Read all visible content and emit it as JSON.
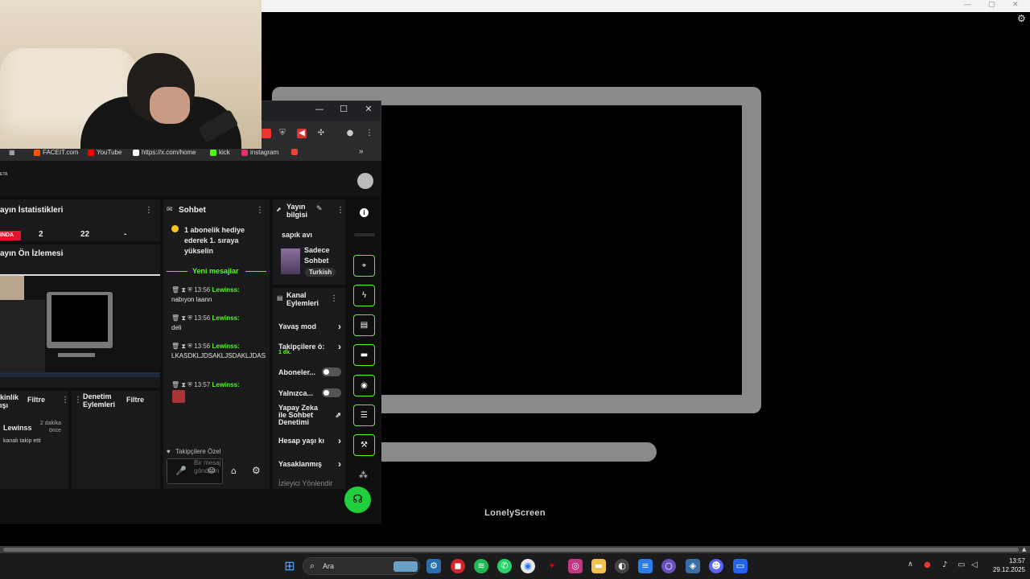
{
  "host": {
    "app_label": "LonelyScreen",
    "controls": {
      "minimize": "—",
      "maximize": "▢",
      "close": "✕"
    }
  },
  "browser": {
    "controls": {
      "minimize": "—",
      "maximize": "☐",
      "close": "✕"
    },
    "bookmarks": [
      {
        "label": "FACEIT.com",
        "color": "#ff5500"
      },
      {
        "label": "YouTube",
        "color": "#ff0000"
      },
      {
        "label": "https://x.com/home",
        "color": "#ffffff"
      },
      {
        "label": "kick",
        "color": "#53fc18"
      },
      {
        "label": "instagram",
        "color": "#e1306c"
      }
    ],
    "more_label": "»"
  },
  "dashboard": {
    "header_logo": "ETA",
    "stats": {
      "title": "ayın İstatistikleri",
      "live_badge": "INDA",
      "values": [
        "2",
        "22",
        "-"
      ]
    },
    "preview": {
      "title": "ayın Ön İzlemesi"
    },
    "activity": {
      "title": "kinlik\nışı",
      "filter": "Filtre",
      "user": "Lewinss",
      "time": "2 dakika önce",
      "text": "kanalı takip etti"
    },
    "moderation": {
      "title": "Denetim Eylemleri",
      "filter": "Filtre"
    },
    "chat": {
      "title": "Sohbet",
      "pinned": "1 abonelik hediye ederek 1. sıraya yükselin",
      "new_messages": "Yeni mesajlar",
      "messages": [
        {
          "time": "13:56",
          "user": "Lewinss:",
          "text": "nabıyon laann"
        },
        {
          "time": "13:56",
          "user": "Lewinss:",
          "text": "deli"
        },
        {
          "time": "13:56",
          "user": "Lewinss:",
          "text": "LKASDKLJDSAKLJSDAKLJDAS"
        },
        {
          "time": "13:57",
          "user": "Lewinss:",
          "text": ""
        }
      ],
      "followers_only": "Takipçilere Özel",
      "input_placeholder": "Bir mesaj gönderin"
    },
    "stream_info": {
      "title": "Yayın bilgisi",
      "stream_title": "sapık avı",
      "category": "Sadece Sohbet",
      "language": "Turkish"
    },
    "channel_actions": {
      "title": "Kanal Eylemleri",
      "items": [
        {
          "label": "Yavaş mod",
          "type": "arrow"
        },
        {
          "label": "Takipçilere ö:",
          "sub": "1 dk.",
          "type": "arrow"
        },
        {
          "label": "Aboneler...",
          "type": "toggle"
        },
        {
          "label": "Yalnızca...",
          "type": "toggle"
        },
        {
          "label": "Yapay Zeka ile Sohbet Denetimi",
          "type": "ext"
        },
        {
          "label": "Hesap yaşı kı",
          "type": "arrow"
        },
        {
          "label": "Yasaklanmış",
          "type": "arrow"
        },
        {
          "label": "İzleyici Yönlendir",
          "type": "none"
        }
      ]
    }
  },
  "taskbar": {
    "search_placeholder": "Ara",
    "time": "13:57",
    "date": "29.12.2025"
  }
}
